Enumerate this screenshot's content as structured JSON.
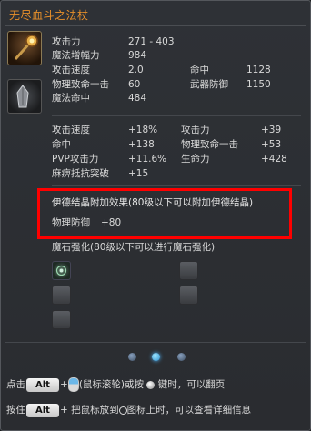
{
  "title": "无尽血斗之法杖",
  "base_stats": [
    {
      "label": "攻击力",
      "value": "271 - 403"
    },
    {
      "label": "魔法增幅力",
      "value": "984"
    },
    {
      "label": "攻击速度",
      "value": "2.0",
      "label2": "命中",
      "value2": "1128"
    },
    {
      "label": "物理致命一击",
      "value": "60",
      "label2": "武器防御",
      "value2": "1150"
    },
    {
      "label": "魔法命中",
      "value": "484"
    }
  ],
  "bonus_stats": [
    {
      "label": "攻击速度",
      "value": "+18%",
      "label2": "攻击力",
      "value2": "+39"
    },
    {
      "label": "命中",
      "value": "+138",
      "label2": "物理致命一击",
      "value2": "+53"
    },
    {
      "label": "PVP攻击力",
      "value": "+11.6%",
      "label2": "生命力",
      "value2": "+428"
    },
    {
      "label": "麻痹抵抗突破",
      "value": "+15"
    }
  ],
  "idian": {
    "title": "伊德结晶附加效果(80级以下可以附加伊德结晶)",
    "stat_label": "物理防御",
    "stat_value": "+80"
  },
  "manastone": {
    "title": "魔石强化(80级以下可以进行魔石强化)"
  },
  "hints": {
    "line1_prefix": "点击",
    "line1_key": "Alt",
    "line1_plus": "+",
    "line1_mid": "(鼠标滚轮)或按",
    "line1_suffix": "键时，可以翻页",
    "line2_prefix": "按住",
    "line2_key": "Alt",
    "line2_mid": "+ 把鼠标放到",
    "line2_suffix": "图标上时，可以查看详细信息"
  },
  "colors": {
    "title": "#e8902a",
    "highlight_border": "#ff0000"
  }
}
